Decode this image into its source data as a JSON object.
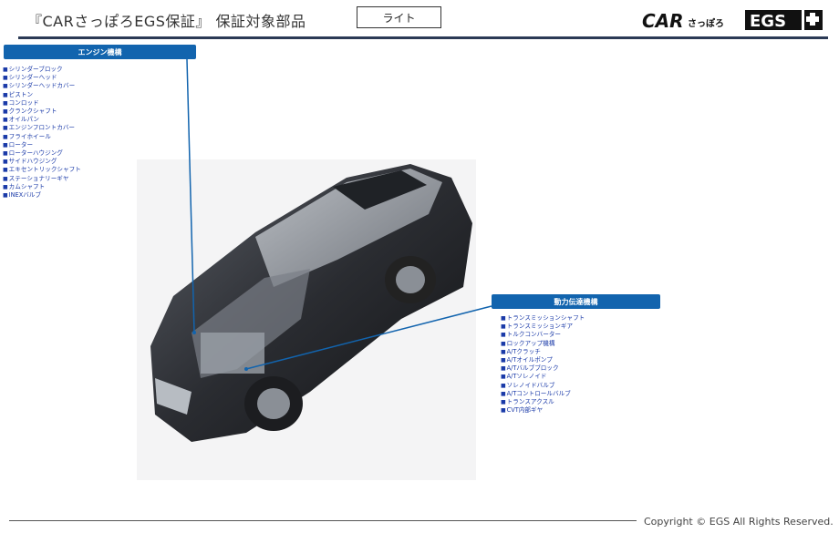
{
  "header": {
    "title": "『CARさっぽろEGS保証』 保証対象部品",
    "plan": "ライト",
    "logo_text": "CARさっぽろ EGS +",
    "rule_color": "#2b3a55"
  },
  "engine": {
    "heading": "エンジン機構",
    "items": [
      "シリンダーブロック",
      "シリンダーヘッド",
      "シリンダーヘッドカバー",
      "ピストン",
      "コンロッド",
      "クランクシャフト",
      "オイルパン",
      "エンジンフロントカバー",
      "フライホイール",
      "ローター",
      "ローターハウジング",
      "サイドハウジング",
      "エキセントリックシャフト",
      "ステーショナリーギヤ",
      "カムシャフト",
      "INEXバルブ"
    ]
  },
  "transmission": {
    "heading": "動力伝達機構",
    "items": [
      "トランスミッションシャフト",
      "トランスミッションギア",
      "トルクコンバーター",
      "ロックアップ機構",
      "A/Tクラッチ",
      "A/Tオイルポンプ",
      "A/Tバルブブロック",
      "A/Tソレノイド",
      "ソレノイドバルブ",
      "A/Tコントロールバルブ",
      "トランスアクスル",
      "CVT内部ギヤ"
    ]
  },
  "footer": {
    "copyright": "Copyright © EGS All Rights Reserved."
  },
  "colors": {
    "accent": "#1264ae",
    "list_text": "#1a3aa8"
  }
}
